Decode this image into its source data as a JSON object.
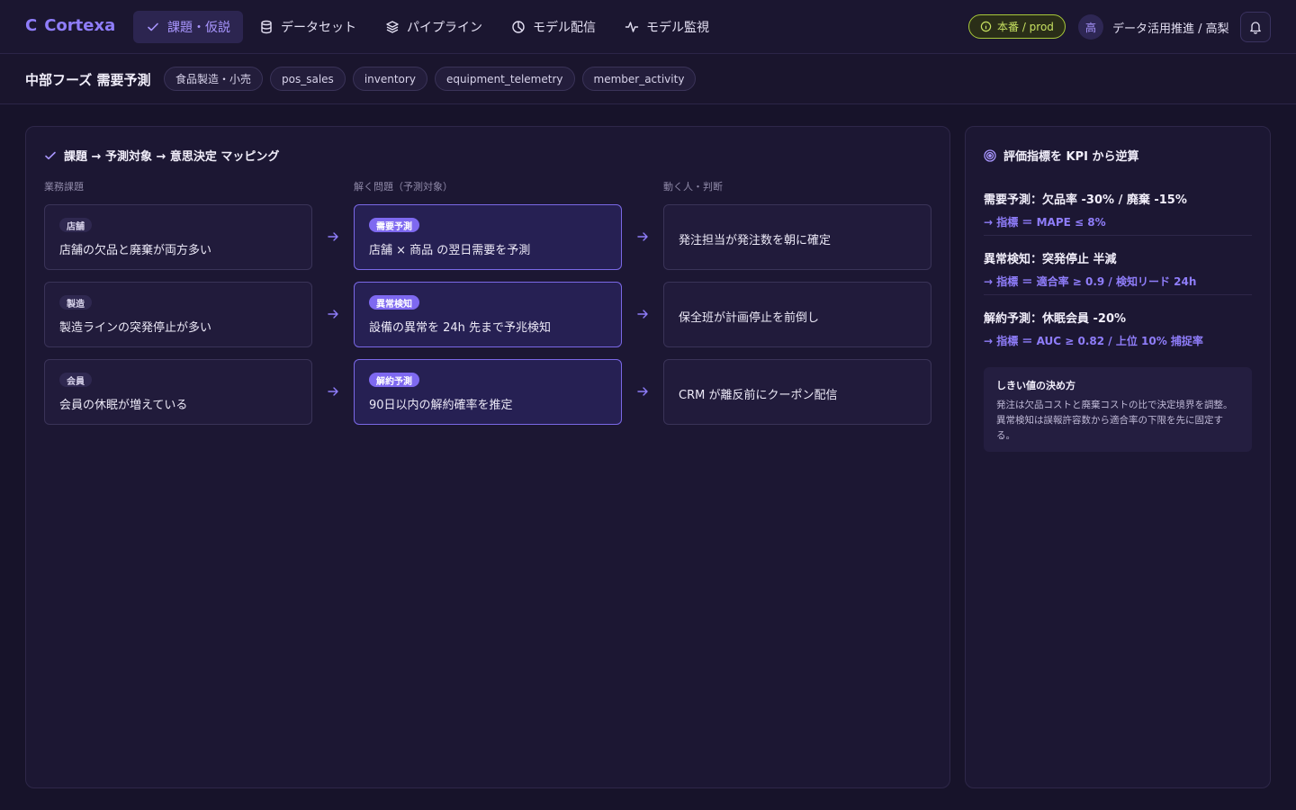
{
  "app": {
    "brand_mark": "C",
    "brand_name": "Cortexa"
  },
  "nav": {
    "tabs": [
      {
        "label": "課題・仮説",
        "icon": "check-icon",
        "active": true
      },
      {
        "label": "データセット",
        "icon": "database-icon",
        "active": false
      },
      {
        "label": "パイプライン",
        "icon": "layers-icon",
        "active": false
      },
      {
        "label": "モデル配信",
        "icon": "pie-icon",
        "active": false
      },
      {
        "label": "モデル監視",
        "icon": "activity-icon",
        "active": false
      }
    ],
    "env_badge": "本番 / prod",
    "user_avatar": "高",
    "user_label": "データ活用推進 / 高梨"
  },
  "project": {
    "title": "中部フーズ 需要予測",
    "chips": [
      "食品製造・小売",
      "pos_sales",
      "inventory",
      "equipment_telemetry",
      "member_activity"
    ]
  },
  "mapping": {
    "title": "課題 → 予測対象 → 意思決定 マッピング",
    "col_labels": [
      "業務課題",
      "解く問題（予測対象）",
      "動く人・判断"
    ],
    "rows": [
      {
        "issue_tag": "店舗",
        "issue": "店舗の欠品と廃棄が両方多い",
        "problem_tag": "需要予測",
        "problem": "店舗 × 商品 の翌日需要を予測",
        "action": "発注担当が発注数を朝に確定"
      },
      {
        "issue_tag": "製造",
        "issue": "製造ラインの突発停止が多い",
        "problem_tag": "異常検知",
        "problem": "設備の異常を 24h 先まで予兆検知",
        "action": "保全班が計画停止を前倒し"
      },
      {
        "issue_tag": "会員",
        "issue": "会員の休眠が増えている",
        "problem_tag": "解約予測",
        "problem": "90日以内の解約確率を推定",
        "action": "CRM が離反前にクーポン配信"
      }
    ]
  },
  "kpi": {
    "title": "評価指標を KPI から逆算",
    "items": [
      {
        "title": "需要予測：欠品率 -30% / 廃棄 -15%",
        "metric": "→ 指標 ＝ MAPE ≤ 8%"
      },
      {
        "title": "異常検知：突発停止 半減",
        "metric": "→ 指標 ＝ 適合率 ≥ 0.9 / 検知リード 24h"
      },
      {
        "title": "解約予測：休眠会員 -20%",
        "metric": "→ 指標 ＝ AUC ≥ 0.82 / 上位 10% 捕捉率"
      }
    ],
    "note_title": "しきい値の決め方",
    "note_body": "発注は欠品コストと廃棄コストの比で決定境界を調整。異常検知は誤報許容数から適合率の下限を先に固定する。"
  },
  "colors": {
    "accent": "#8f7dfa",
    "prod_badge": "#c6e060",
    "background": "#17132a"
  }
}
